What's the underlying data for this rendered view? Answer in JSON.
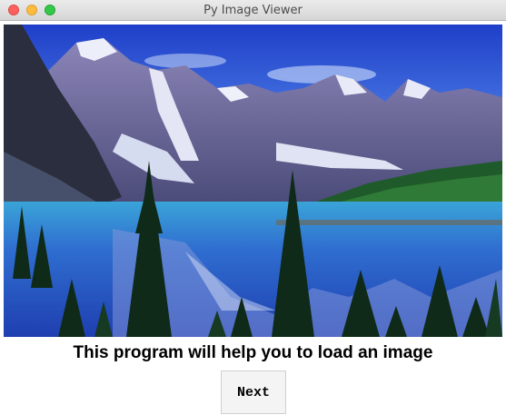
{
  "window": {
    "title": "Py Image Viewer"
  },
  "main": {
    "caption": "This program will help you to load an image",
    "next_label": "Next"
  }
}
